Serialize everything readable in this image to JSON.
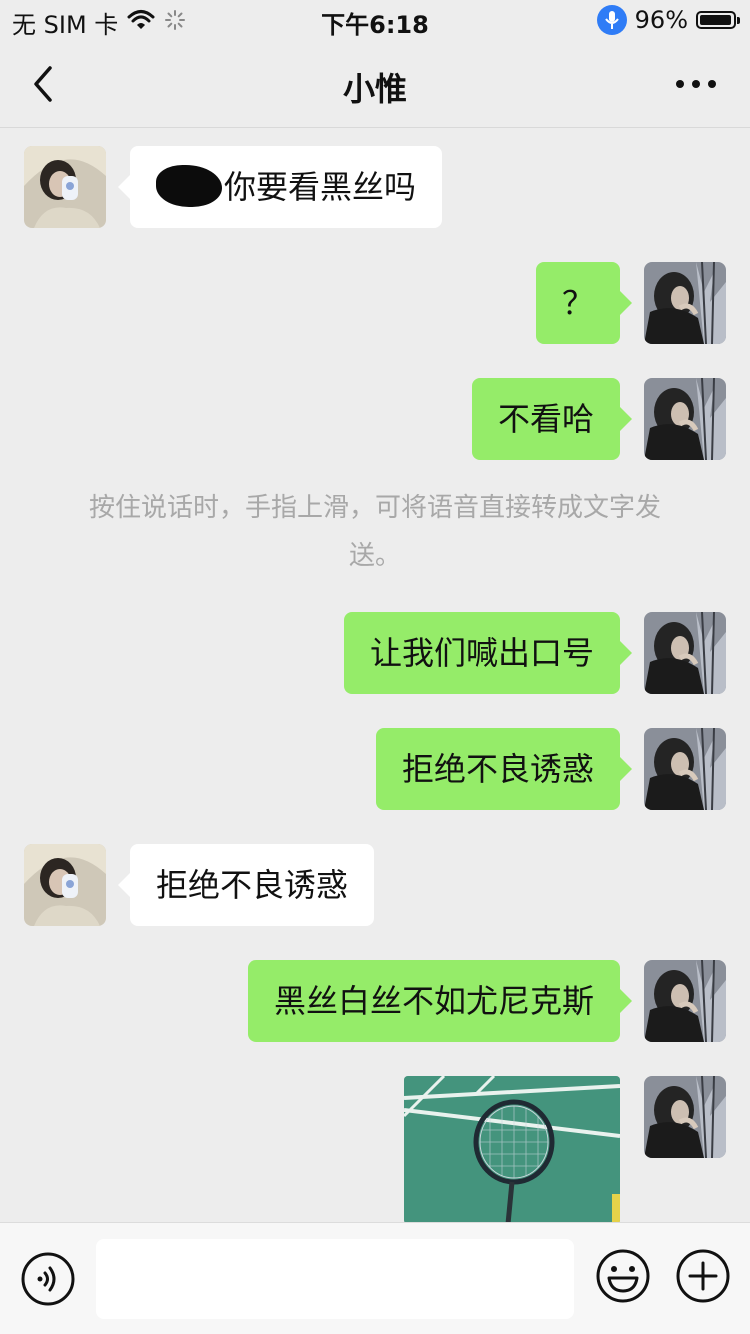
{
  "status_bar": {
    "carrier": "无 SIM 卡",
    "time": "下午6:18",
    "battery_percent": "96%",
    "battery_level": 0.96
  },
  "nav": {
    "title": "小惟",
    "back_icon": "chevron-left-icon",
    "more_icon": "more-dots-icon"
  },
  "messages": [
    {
      "side": "left",
      "text": "你要看黑丝吗",
      "redacted_prefix": true
    },
    {
      "side": "right",
      "text": "？"
    },
    {
      "side": "right",
      "text": "不看哈"
    },
    {
      "side": "right",
      "text": "让我们喊出口号"
    },
    {
      "side": "right",
      "text": "拒绝不良诱惑"
    },
    {
      "side": "left",
      "text": "拒绝不良诱惑"
    },
    {
      "side": "right",
      "text": "黑丝白丝不如尤尼克斯"
    },
    {
      "side": "right",
      "type": "image"
    }
  ],
  "system_tip": {
    "line1": "按住说话时，手指上滑，可将语音直接转成文字发",
    "line2": "送。"
  },
  "input_bar": {
    "value": "",
    "placeholder": "",
    "voice_icon": "voice-icon",
    "emoji_icon": "emoji-icon",
    "plus_icon": "plus-icon"
  },
  "colors": {
    "background": "#ededed",
    "incoming_bubble": "#ffffff",
    "outgoing_bubble": "#95ec69",
    "tip_text": "#a8a8a8"
  }
}
